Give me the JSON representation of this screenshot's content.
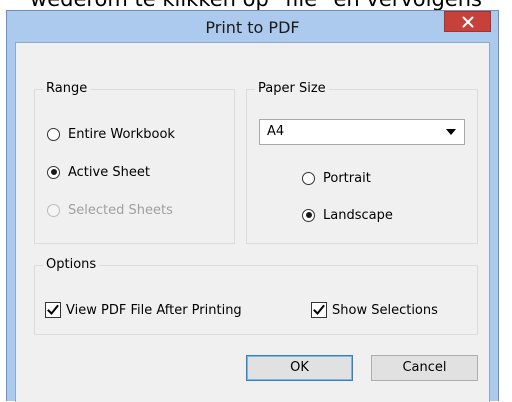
{
  "background": {
    "text": "wederom te klikken op \"file\" en vervolgens"
  },
  "dialog": {
    "title": "Print to PDF",
    "close_glyph": "×"
  },
  "range": {
    "label": "Range",
    "options": [
      {
        "label": "Entire Workbook",
        "checked": false,
        "disabled": false
      },
      {
        "label": "Active Sheet",
        "checked": true,
        "disabled": false
      },
      {
        "label": "Selected Sheets",
        "checked": false,
        "disabled": true
      }
    ]
  },
  "paper_size": {
    "label": "Paper Size",
    "selected": "A4",
    "orientation": [
      {
        "label": "Portrait",
        "checked": false
      },
      {
        "label": "Landscape",
        "checked": true
      }
    ]
  },
  "options": {
    "label": "Options",
    "checkboxes": [
      {
        "label": "View PDF File After Printing",
        "checked": true
      },
      {
        "label": "Show Selections",
        "checked": true
      }
    ]
  },
  "buttons": {
    "ok": "OK",
    "cancel": "Cancel"
  },
  "colors": {
    "frame": "#acc9ee",
    "close_button": "#c7413a",
    "client": "#f0f0f0"
  }
}
